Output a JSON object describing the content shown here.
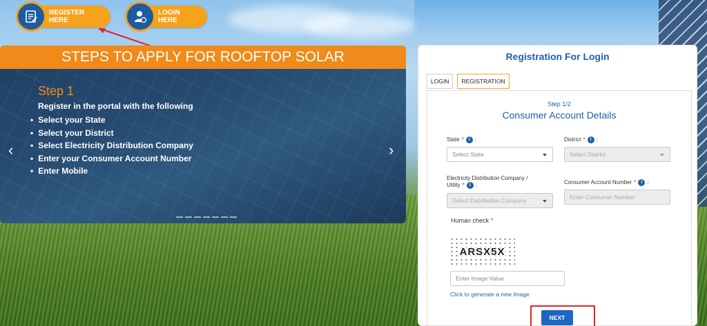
{
  "top_buttons": {
    "register_label": "REGISTER HERE",
    "login_label": "LOGIN HERE"
  },
  "carousel": {
    "heading": "STEPS TO APPLY FOR ROOFTOP SOLAR",
    "step_title": "Step 1",
    "intro": "Register in the portal with the following",
    "items": [
      "Select your State",
      "Select your District",
      "Select Electricity Distribution Company",
      "Enter your Consumer Account Number",
      "Enter Mobile"
    ],
    "prev_glyph": "‹",
    "next_glyph": "›"
  },
  "card": {
    "title": "Registration For Login",
    "tabs": [
      "LOGIN",
      "REGISTRATION"
    ],
    "active_tab": "REGISTRATION",
    "step": "Step 1/2",
    "form_title": "Consumer Account Details",
    "state_label": "State",
    "state_placeholder": "Select State",
    "district_label": "District",
    "district_placeholder": "Select District",
    "discom_label_line1": "Electricity Distribution Company /",
    "discom_label_line2": "Utility",
    "discom_placeholder": "Select Distribution Company",
    "consumer_label": "Consumer Account Number",
    "consumer_placeholder": "Enter Consumer Number",
    "human_check_label": "Human check",
    "captcha_text": "ARSX5X",
    "image_value_placeholder": "Enter Image Value",
    "regenerate_link": "Click to generate a new Image",
    "next_label": "NEXT",
    "required_mark": "*",
    "info_glyph": "i",
    "colon": ":"
  },
  "colors": {
    "accent_orange": "#f08a1a",
    "primary_blue": "#1f5fa8",
    "annotation_red": "#e0242a"
  }
}
